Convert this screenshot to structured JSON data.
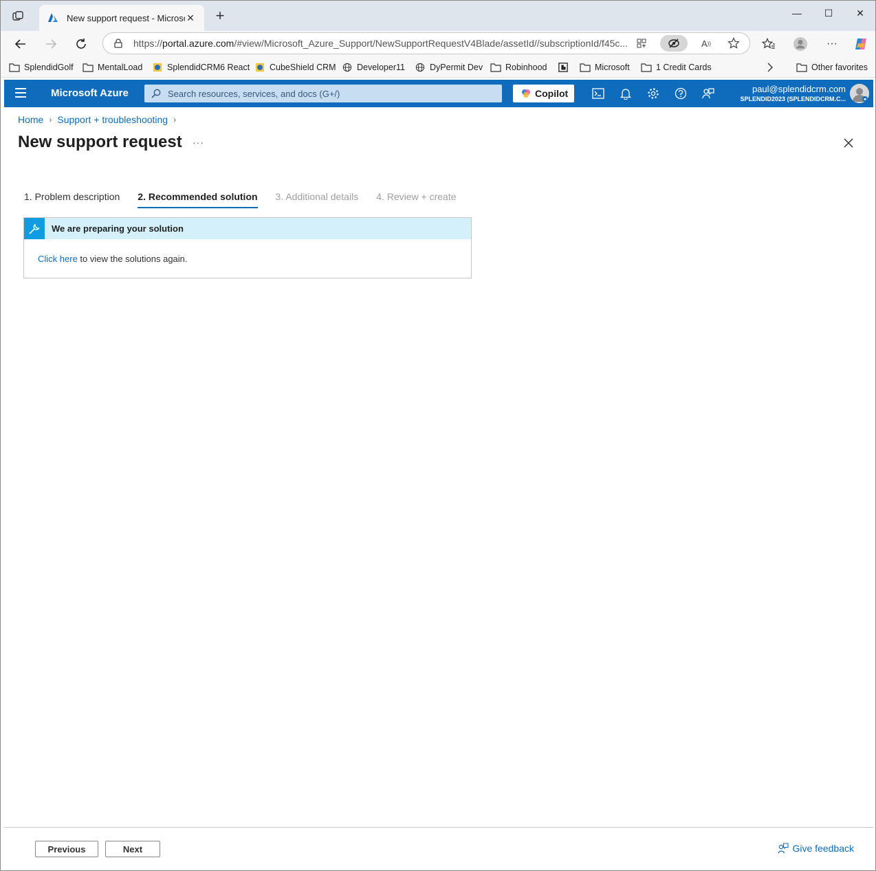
{
  "browser": {
    "tab_title": "New support request - Microsoft",
    "url_prefix": "https://",
    "url_host": "portal.azure.com",
    "url_path": "/#view/Microsoft_Azure_Support/NewSupportRequestV4Blade/assetId//subscriptionId/f45c...",
    "bookmarks": [
      "SplendidGolf",
      "MentalLoad",
      "SplendidCRM6 React",
      "CubeShield CRM",
      "Developer11",
      "DyPermit Dev",
      "Robinhood",
      "Microsoft",
      "1 Credit Cards"
    ],
    "other_favorites": "Other favorites"
  },
  "azure": {
    "brand": "Microsoft Azure",
    "search_placeholder": "Search resources, services, and docs (G+/)",
    "copilot_label": "Copilot",
    "account_email": "paul@splendidcrm.com",
    "account_tenant": "SPLENDID2023 (SPLENDIDCRM.C..."
  },
  "breadcrumb": [
    "Home",
    "Support + troubleshooting"
  ],
  "page": {
    "title": "New support request",
    "more": "···"
  },
  "steps": [
    {
      "label": "1. Problem description",
      "state": "done"
    },
    {
      "label": "2. Recommended solution",
      "state": "active"
    },
    {
      "label": "3. Additional details",
      "state": "disabled"
    },
    {
      "label": "4. Review + create",
      "state": "disabled"
    }
  ],
  "notice": {
    "title": "We are preparing your solution",
    "link_text": "Click here",
    "body_text": " to view the solutions again."
  },
  "footer": {
    "previous": "Previous",
    "next": "Next",
    "feedback": "Give feedback"
  },
  "colors": {
    "azure_blue": "#0f6cbd",
    "info_bg": "#d4f0fa",
    "info_icon_bg": "#0f9ce0"
  }
}
